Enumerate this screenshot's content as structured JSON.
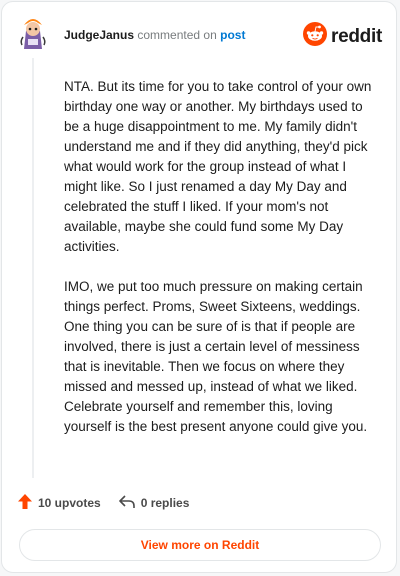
{
  "header": {
    "username": "JudgeJanus",
    "action_text": "commented on",
    "post_link": "post"
  },
  "brand": {
    "name": "reddit",
    "color": "#ff4500"
  },
  "comment": {
    "paragraphs": [
      "NTA. But its time for you to take control of your own birthday one way or another. My birthdays used to be a huge disappointment to me. My family didn't understand me and if they did anything, they'd pick what would work for the group instead of what I might like. So I just renamed a day My Day and celebrated the stuff I liked. If your mom's not available, maybe she could fund some My Day activities.",
      "IMO, we put too much pressure on making certain things perfect. Proms, Sweet Sixteens, weddings. One thing you can be sure of is that if people are involved, there is just a certain level of messiness that is inevitable. Then we focus on where they missed and messed up, instead of what we liked. Celebrate yourself and remember this, loving yourself is the best present anyone could give you."
    ]
  },
  "actions": {
    "upvotes": "10 upvotes",
    "replies": "0 replies",
    "upvote_icon": "upvote-arrow-icon",
    "reply_icon": "reply-arrow-icon"
  },
  "footer": {
    "view_more": "View more on Reddit"
  }
}
